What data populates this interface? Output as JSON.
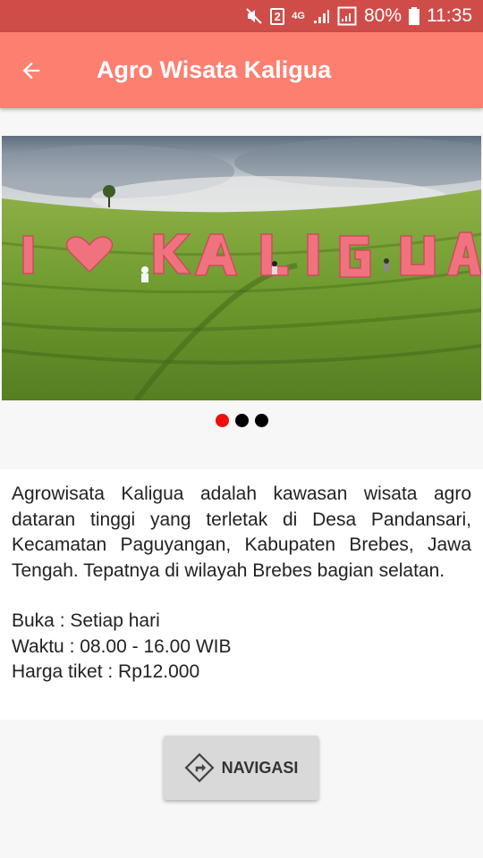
{
  "status_bar": {
    "sim_slot": "2",
    "network": "4G",
    "battery_percent": "80%",
    "time": "11:35"
  },
  "app_bar": {
    "title": "Agro Wisata Kaligua"
  },
  "carousel": {
    "sign_text": "I ♥ KALIGUA",
    "slide_count": 3,
    "active_index": 0,
    "active_color": "#f20d0d"
  },
  "description": {
    "paragraph": "Agrowisata Kaligua adalah kawasan wisata agro dataran tinggi yang terletak di Desa Pandansari, Kecamatan Paguyangan, Kabupaten Brebes, Jawa Tengah. Tepatnya di wilayah Brebes bagian selatan.",
    "open": "Buka : Setiap hari",
    "hours": "Waktu : 08.00 - 16.00 WIB",
    "price": "Harga tiket : Rp12.000"
  },
  "navigation_button": {
    "label": "NAVIGASI",
    "icon": "directions-icon"
  },
  "colors": {
    "app_bar": "#fd7f70",
    "status_bar": "#cf4c48"
  }
}
